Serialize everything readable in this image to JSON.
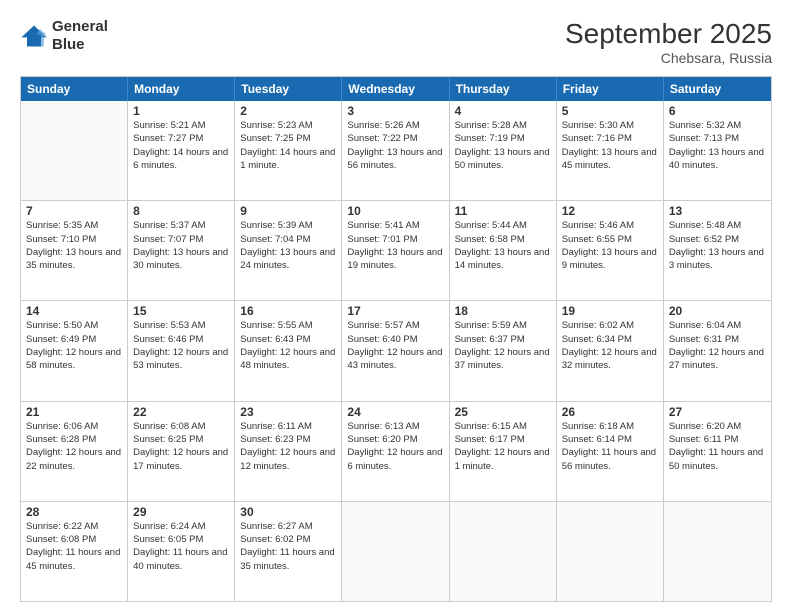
{
  "logo": {
    "line1": "General",
    "line2": "Blue"
  },
  "title": "September 2025",
  "subtitle": "Chebsara, Russia",
  "header": {
    "days": [
      "Sunday",
      "Monday",
      "Tuesday",
      "Wednesday",
      "Thursday",
      "Friday",
      "Saturday"
    ]
  },
  "weeks": [
    [
      {
        "day": "",
        "sunrise": "",
        "sunset": "",
        "daylight": ""
      },
      {
        "day": "1",
        "sunrise": "Sunrise: 5:21 AM",
        "sunset": "Sunset: 7:27 PM",
        "daylight": "Daylight: 14 hours and 6 minutes."
      },
      {
        "day": "2",
        "sunrise": "Sunrise: 5:23 AM",
        "sunset": "Sunset: 7:25 PM",
        "daylight": "Daylight: 14 hours and 1 minute."
      },
      {
        "day": "3",
        "sunrise": "Sunrise: 5:26 AM",
        "sunset": "Sunset: 7:22 PM",
        "daylight": "Daylight: 13 hours and 56 minutes."
      },
      {
        "day": "4",
        "sunrise": "Sunrise: 5:28 AM",
        "sunset": "Sunset: 7:19 PM",
        "daylight": "Daylight: 13 hours and 50 minutes."
      },
      {
        "day": "5",
        "sunrise": "Sunrise: 5:30 AM",
        "sunset": "Sunset: 7:16 PM",
        "daylight": "Daylight: 13 hours and 45 minutes."
      },
      {
        "day": "6",
        "sunrise": "Sunrise: 5:32 AM",
        "sunset": "Sunset: 7:13 PM",
        "daylight": "Daylight: 13 hours and 40 minutes."
      }
    ],
    [
      {
        "day": "7",
        "sunrise": "Sunrise: 5:35 AM",
        "sunset": "Sunset: 7:10 PM",
        "daylight": "Daylight: 13 hours and 35 minutes."
      },
      {
        "day": "8",
        "sunrise": "Sunrise: 5:37 AM",
        "sunset": "Sunset: 7:07 PM",
        "daylight": "Daylight: 13 hours and 30 minutes."
      },
      {
        "day": "9",
        "sunrise": "Sunrise: 5:39 AM",
        "sunset": "Sunset: 7:04 PM",
        "daylight": "Daylight: 13 hours and 24 minutes."
      },
      {
        "day": "10",
        "sunrise": "Sunrise: 5:41 AM",
        "sunset": "Sunset: 7:01 PM",
        "daylight": "Daylight: 13 hours and 19 minutes."
      },
      {
        "day": "11",
        "sunrise": "Sunrise: 5:44 AM",
        "sunset": "Sunset: 6:58 PM",
        "daylight": "Daylight: 13 hours and 14 minutes."
      },
      {
        "day": "12",
        "sunrise": "Sunrise: 5:46 AM",
        "sunset": "Sunset: 6:55 PM",
        "daylight": "Daylight: 13 hours and 9 minutes."
      },
      {
        "day": "13",
        "sunrise": "Sunrise: 5:48 AM",
        "sunset": "Sunset: 6:52 PM",
        "daylight": "Daylight: 13 hours and 3 minutes."
      }
    ],
    [
      {
        "day": "14",
        "sunrise": "Sunrise: 5:50 AM",
        "sunset": "Sunset: 6:49 PM",
        "daylight": "Daylight: 12 hours and 58 minutes."
      },
      {
        "day": "15",
        "sunrise": "Sunrise: 5:53 AM",
        "sunset": "Sunset: 6:46 PM",
        "daylight": "Daylight: 12 hours and 53 minutes."
      },
      {
        "day": "16",
        "sunrise": "Sunrise: 5:55 AM",
        "sunset": "Sunset: 6:43 PM",
        "daylight": "Daylight: 12 hours and 48 minutes."
      },
      {
        "day": "17",
        "sunrise": "Sunrise: 5:57 AM",
        "sunset": "Sunset: 6:40 PM",
        "daylight": "Daylight: 12 hours and 43 minutes."
      },
      {
        "day": "18",
        "sunrise": "Sunrise: 5:59 AM",
        "sunset": "Sunset: 6:37 PM",
        "daylight": "Daylight: 12 hours and 37 minutes."
      },
      {
        "day": "19",
        "sunrise": "Sunrise: 6:02 AM",
        "sunset": "Sunset: 6:34 PM",
        "daylight": "Daylight: 12 hours and 32 minutes."
      },
      {
        "day": "20",
        "sunrise": "Sunrise: 6:04 AM",
        "sunset": "Sunset: 6:31 PM",
        "daylight": "Daylight: 12 hours and 27 minutes."
      }
    ],
    [
      {
        "day": "21",
        "sunrise": "Sunrise: 6:06 AM",
        "sunset": "Sunset: 6:28 PM",
        "daylight": "Daylight: 12 hours and 22 minutes."
      },
      {
        "day": "22",
        "sunrise": "Sunrise: 6:08 AM",
        "sunset": "Sunset: 6:25 PM",
        "daylight": "Daylight: 12 hours and 17 minutes."
      },
      {
        "day": "23",
        "sunrise": "Sunrise: 6:11 AM",
        "sunset": "Sunset: 6:23 PM",
        "daylight": "Daylight: 12 hours and 12 minutes."
      },
      {
        "day": "24",
        "sunrise": "Sunrise: 6:13 AM",
        "sunset": "Sunset: 6:20 PM",
        "daylight": "Daylight: 12 hours and 6 minutes."
      },
      {
        "day": "25",
        "sunrise": "Sunrise: 6:15 AM",
        "sunset": "Sunset: 6:17 PM",
        "daylight": "Daylight: 12 hours and 1 minute."
      },
      {
        "day": "26",
        "sunrise": "Sunrise: 6:18 AM",
        "sunset": "Sunset: 6:14 PM",
        "daylight": "Daylight: 11 hours and 56 minutes."
      },
      {
        "day": "27",
        "sunrise": "Sunrise: 6:20 AM",
        "sunset": "Sunset: 6:11 PM",
        "daylight": "Daylight: 11 hours and 50 minutes."
      }
    ],
    [
      {
        "day": "28",
        "sunrise": "Sunrise: 6:22 AM",
        "sunset": "Sunset: 6:08 PM",
        "daylight": "Daylight: 11 hours and 45 minutes."
      },
      {
        "day": "29",
        "sunrise": "Sunrise: 6:24 AM",
        "sunset": "Sunset: 6:05 PM",
        "daylight": "Daylight: 11 hours and 40 minutes."
      },
      {
        "day": "30",
        "sunrise": "Sunrise: 6:27 AM",
        "sunset": "Sunset: 6:02 PM",
        "daylight": "Daylight: 11 hours and 35 minutes."
      },
      {
        "day": "",
        "sunrise": "",
        "sunset": "",
        "daylight": ""
      },
      {
        "day": "",
        "sunrise": "",
        "sunset": "",
        "daylight": ""
      },
      {
        "day": "",
        "sunrise": "",
        "sunset": "",
        "daylight": ""
      },
      {
        "day": "",
        "sunrise": "",
        "sunset": "",
        "daylight": ""
      }
    ]
  ]
}
